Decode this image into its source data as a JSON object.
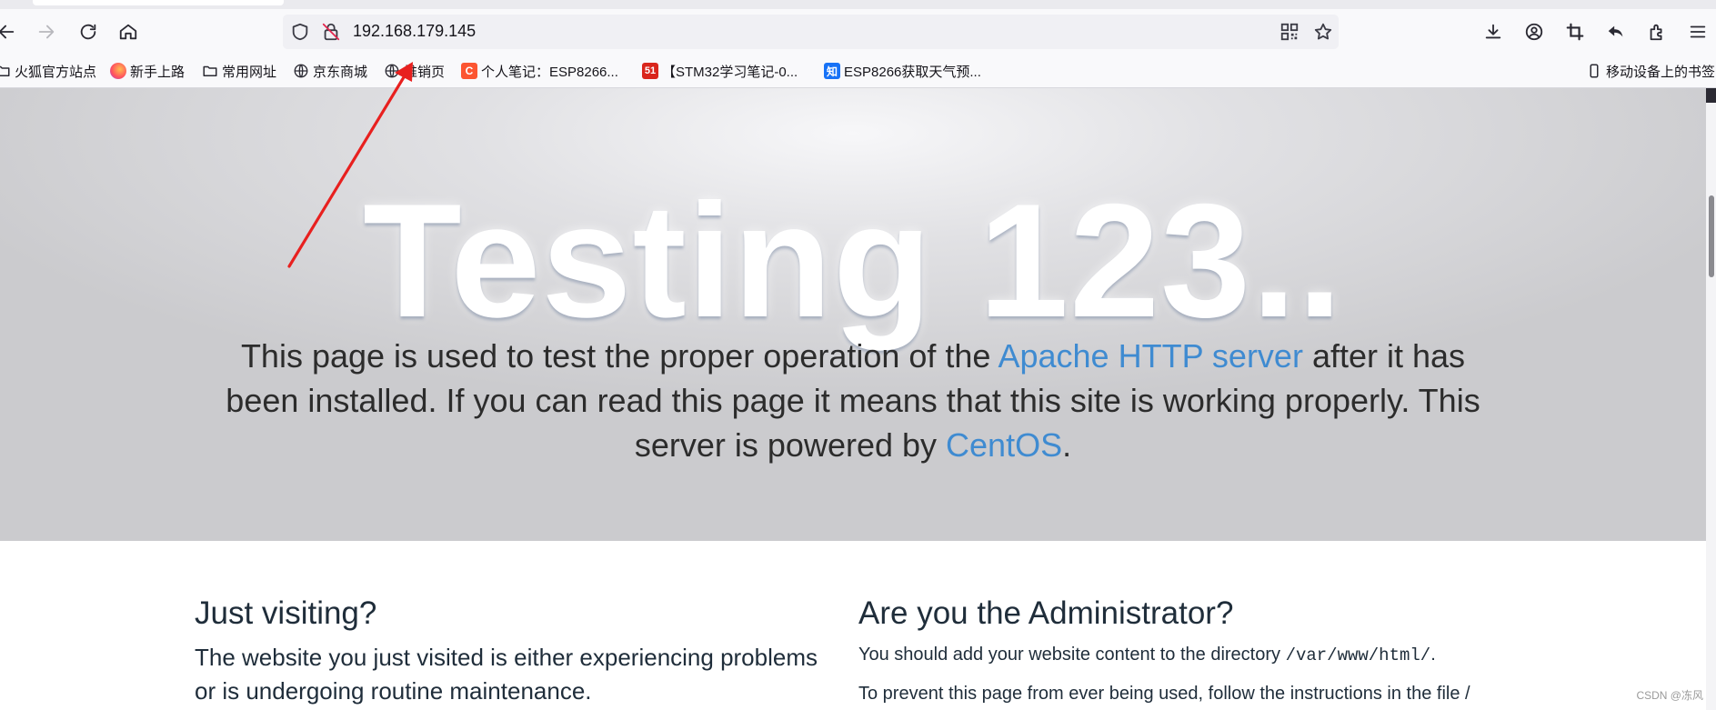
{
  "browser": {
    "url": "192.168.179.145",
    "nav_icons": [
      "back-icon",
      "forward-icon",
      "reload-icon",
      "home-icon"
    ],
    "url_icons": [
      "shield-icon",
      "not-secure-lock-icon",
      "qr-code-icon",
      "bookmark-star-icon"
    ],
    "toolbar_icons": [
      "download-icon",
      "account-icon",
      "screenshot-crop-icon",
      "undo-icon",
      "extensions-icon",
      "menu-icon"
    ]
  },
  "bookmarks": {
    "items": [
      {
        "label": "火狐官方站点",
        "icon": "folder-icon"
      },
      {
        "label": "新手上路",
        "icon": "firefox-icon"
      },
      {
        "label": "常用网址",
        "icon": "folder-icon"
      },
      {
        "label": "京东商城",
        "icon": "globe-icon"
      },
      {
        "label": "推销页",
        "icon": "globe-icon"
      },
      {
        "label": "个人笔记：ESP8266...",
        "icon": "csdn-c-icon"
      },
      {
        "label": "【STM32学习笔记-0...",
        "icon": "51cto-icon"
      },
      {
        "label": "ESP8266获取天气预...",
        "icon": "zhihu-icon"
      }
    ],
    "mobile_label": "移动设备上的书签"
  },
  "hero": {
    "title": "Testing 123..",
    "lead_part1": "This page is used to test the proper operation of the ",
    "apache_link": "Apache HTTP server",
    "lead_part2": " after it has been installed. If you can read this page it means that this site is working properly. This server is powered by ",
    "centos_link": "CentOS",
    "lead_end": "."
  },
  "visitor": {
    "heading": "Just visiting?",
    "text": "The website you just visited is either experiencing problems or is undergoing routine maintenance."
  },
  "admin": {
    "heading": "Are you the Administrator?",
    "text1_prefix": "You should add your website content to the directory ",
    "directory": "/var/www/html/",
    "text1_suffix": ".",
    "text2": "To prevent this page from ever being used, follow the instructions in the file /"
  },
  "watermark": "CSDN @冻风",
  "colors": {
    "link": "#3f8bd1",
    "annotation_arrow": "#e8201f",
    "heading_text": "#1f2d3a"
  }
}
